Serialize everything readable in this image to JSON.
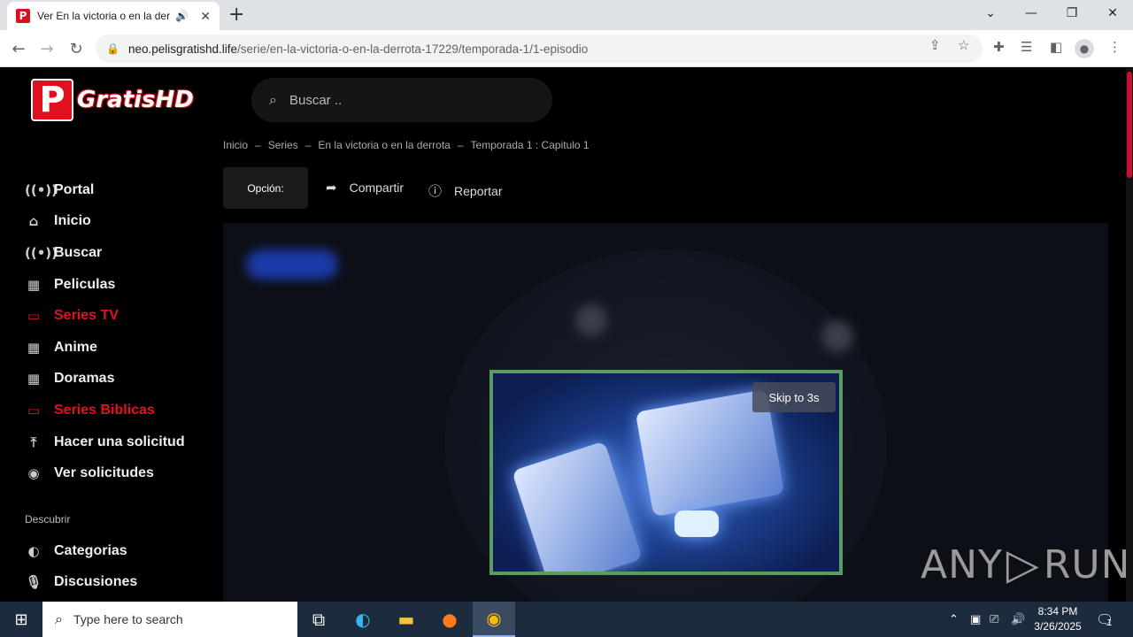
{
  "browser": {
    "tab_title": "Ver En la victoria o en la derr",
    "favicon_letter": "P",
    "url_domain": "neo.pelisgratishd.life",
    "url_path": "/serie/en-la-victoria-o-en-la-derrota-17229/temporada-1/1-episodio"
  },
  "site": {
    "logo_letter": "P",
    "logo_text": "GratisHD",
    "search_placeholder": "Buscar .."
  },
  "breadcrumb": [
    "Inicio",
    "–",
    "Series",
    "–",
    "En la victoria o en la derrota",
    "–",
    "Temporada 1 : Capitulo 1"
  ],
  "actions": {
    "option_label": "Opción:",
    "share_label": "Compartir",
    "report_label": "Reportar"
  },
  "menu": [
    {
      "label": "Portal",
      "icon": "broadcast-icon",
      "glyph": "((•))",
      "active": false
    },
    {
      "label": "Inicio",
      "icon": "home-icon",
      "glyph": "⌂",
      "active": false
    },
    {
      "label": "Buscar",
      "icon": "broadcast-icon",
      "glyph": "((•))",
      "active": false
    },
    {
      "label": "Peliculas",
      "icon": "film-icon",
      "glyph": "▦",
      "active": false
    },
    {
      "label": "Series TV",
      "icon": "tv-icon",
      "glyph": "▭",
      "active": true
    },
    {
      "label": "Anime",
      "icon": "film-icon",
      "glyph": "▦",
      "active": false
    },
    {
      "label": "Doramas",
      "icon": "film-icon",
      "glyph": "▦",
      "active": false
    },
    {
      "label": "Series Biblicas",
      "icon": "tv-icon",
      "glyph": "▭",
      "active": true
    },
    {
      "label": "Hacer una solicitud",
      "icon": "upload-icon",
      "glyph": "⤒",
      "active": false
    },
    {
      "label": "Ver solicitudes",
      "icon": "eye-icon",
      "glyph": "◉",
      "active": false
    }
  ],
  "discover": {
    "label": "Descubrir",
    "items": [
      {
        "label": "Categorias",
        "icon": "half-circle-icon",
        "glyph": "◐"
      },
      {
        "label": "Discusiones",
        "icon": "microphone-icon",
        "glyph": "🎙"
      }
    ]
  },
  "player": {
    "skip_label": "Skip to 3s"
  },
  "watermark": {
    "left": "ANY",
    "right": "RUN"
  },
  "taskbar": {
    "search_placeholder": "Type here to search",
    "time": "8:34 PM",
    "date": "3/26/2025",
    "notification_count": "1"
  }
}
